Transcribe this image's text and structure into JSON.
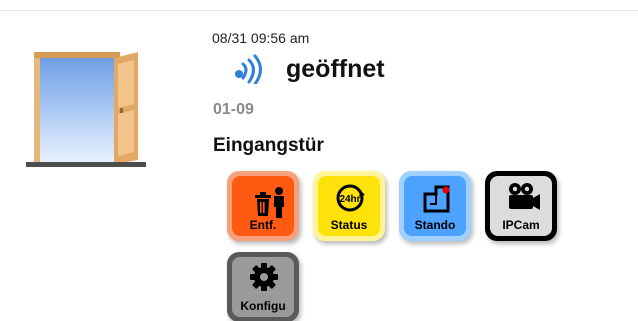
{
  "event": {
    "timestamp": "08/31 09:56 am",
    "status": "geöffnet",
    "zone_id": "01-09",
    "zone_name": "Eingangstür"
  },
  "actions": {
    "delete_label": "Entf.",
    "status_label": "Status",
    "status_badge": "24hr",
    "location_label": "Stando",
    "ipcam_label": "IPCam",
    "config_label": "Konfigu"
  },
  "icons": {
    "door": "open-door-icon",
    "signal": "wireless-signal-icon",
    "delete": "trash-person-icon",
    "status": "24hr-clock-icon",
    "location": "location-pin-icon",
    "ipcam": "video-camera-icon",
    "config": "gear-icon"
  },
  "colors": {
    "delete": "#ff5a12",
    "status": "#ffe20a",
    "location": "#4da2ff",
    "ipcam": "#dcdcdc",
    "config": "#9a9a9a",
    "signal": "#2e7fd8"
  }
}
